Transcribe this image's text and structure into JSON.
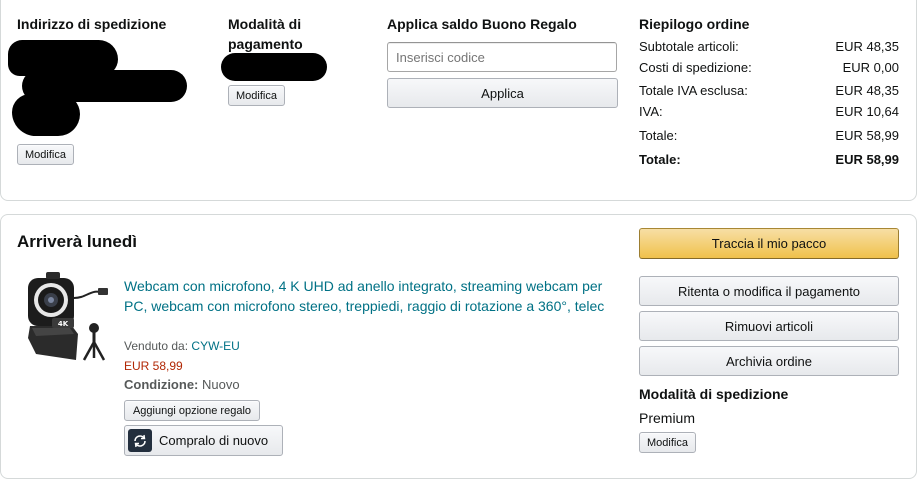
{
  "shipping_address": {
    "heading": "Indirizzo di spedizione",
    "edit_label": "Modifica"
  },
  "payment_method": {
    "heading": "Modalità di pagamento",
    "edit_label": "Modifica"
  },
  "gift_card": {
    "heading": "Applica saldo Buono Regalo",
    "placeholder": "Inserisci codice",
    "apply_label": "Applica"
  },
  "order_summary": {
    "heading": "Riepilogo ordine",
    "rows": [
      {
        "label": "Subtotale articoli:",
        "value": "EUR 48,35"
      },
      {
        "label": "Costi di spedizione:",
        "value": "EUR 0,00"
      },
      {
        "label": "Totale IVA esclusa:",
        "value": "EUR 48,35"
      },
      {
        "label": "IVA:",
        "value": "EUR 10,64"
      },
      {
        "label": "Totale:",
        "value": "EUR 58,99"
      }
    ],
    "grand_total": {
      "label": "Totale:",
      "value": "EUR 58,99"
    }
  },
  "shipment": {
    "heading": "Arriverà lunedì",
    "product": {
      "title": "Webcam con microfono, 4 K UHD ad anello integrato, streaming webcam per PC, webcam con microfono stereo, treppiedi, raggio di rotazione a 360°, telec",
      "sold_by_label": "Venduto da:",
      "seller": "CYW-EU",
      "price": "EUR 58,99",
      "condition_label": "Condizione:",
      "condition_value": "Nuovo",
      "gift_option_label": "Aggiungi opzione regalo",
      "buy_again_label": "Compralo di nuovo"
    },
    "actions": {
      "track_label": "Traccia il mio pacco",
      "retry_payment_label": "Ritenta o modifica il pagamento",
      "remove_items_label": "Rimuovi articoli",
      "archive_label": "Archivia ordine"
    },
    "shipping_method": {
      "heading": "Modalità di spedizione",
      "value": "Premium",
      "edit_label": "Modifica"
    }
  },
  "colors": {
    "link": "#007185",
    "price": "#B12704",
    "primary_button": "#F0C14B",
    "border": "#D5D9D9"
  }
}
